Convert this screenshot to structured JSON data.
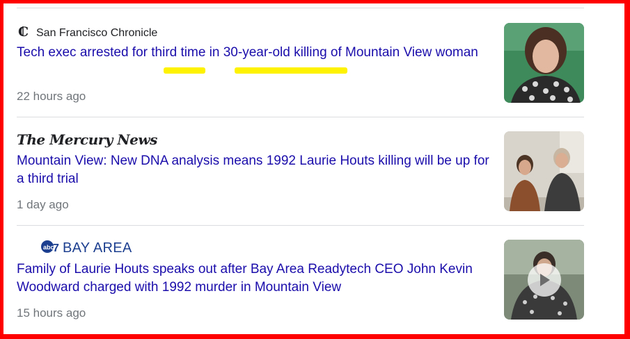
{
  "articles": [
    {
      "source": "San Francisco Chronicle",
      "logo_icon": "chronicle-c-icon",
      "headline": "Tech exec arrested for third time in 30-year-old killing of Mountain View woman",
      "time": "22 hours ago",
      "highlight_color": "#fff200"
    },
    {
      "source": "The Mercury News",
      "headline": "Mountain View: New DNA analysis means 1992 Laurie Houts killing will be up for a third trial",
      "time": "1 day ago"
    },
    {
      "source": "BAY AREA",
      "logo_icon": "abc7-logo-icon",
      "headline": "Family of Laurie Houts speaks out after Bay Area Readytech CEO John Kevin Woodward charged with 1992 murder in Mountain View",
      "time": "15 hours ago",
      "thumbnail_icon": "play-icon"
    }
  ],
  "colors": {
    "frame_border": "#ff0000",
    "link": "#1a0dab",
    "meta": "#70757a",
    "highlight": "#fff200"
  }
}
